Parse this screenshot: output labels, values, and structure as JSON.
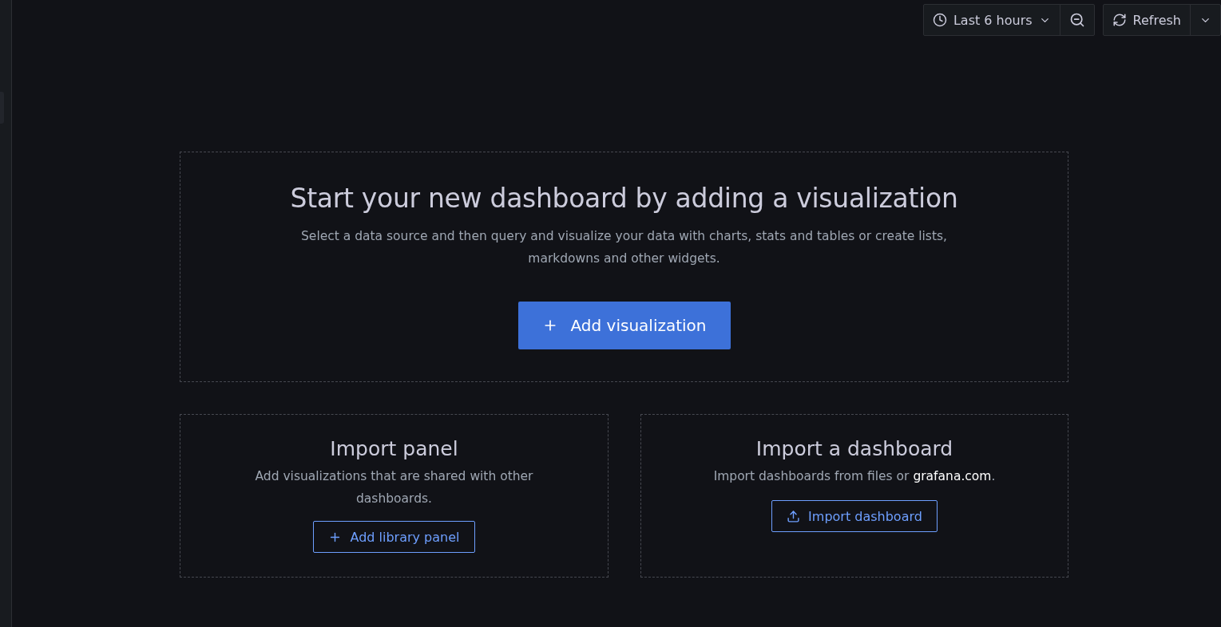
{
  "toolbar": {
    "time_range": "Last 6 hours",
    "refresh": "Refresh"
  },
  "hero": {
    "title": "Start your new dashboard by adding a visualization",
    "description": "Select a data source and then query and visualize your data with charts, stats and tables or create lists, markdowns and other widgets.",
    "button": "Add visualization"
  },
  "import_panel": {
    "title": "Import panel",
    "description": "Add visualizations that are shared with other dashboards.",
    "button": "Add library panel"
  },
  "import_dashboard": {
    "title": "Import a dashboard",
    "description_before": "Import dashboards from files or ",
    "link": "grafana.com",
    "description_after": ".",
    "button": "Import dashboard"
  }
}
